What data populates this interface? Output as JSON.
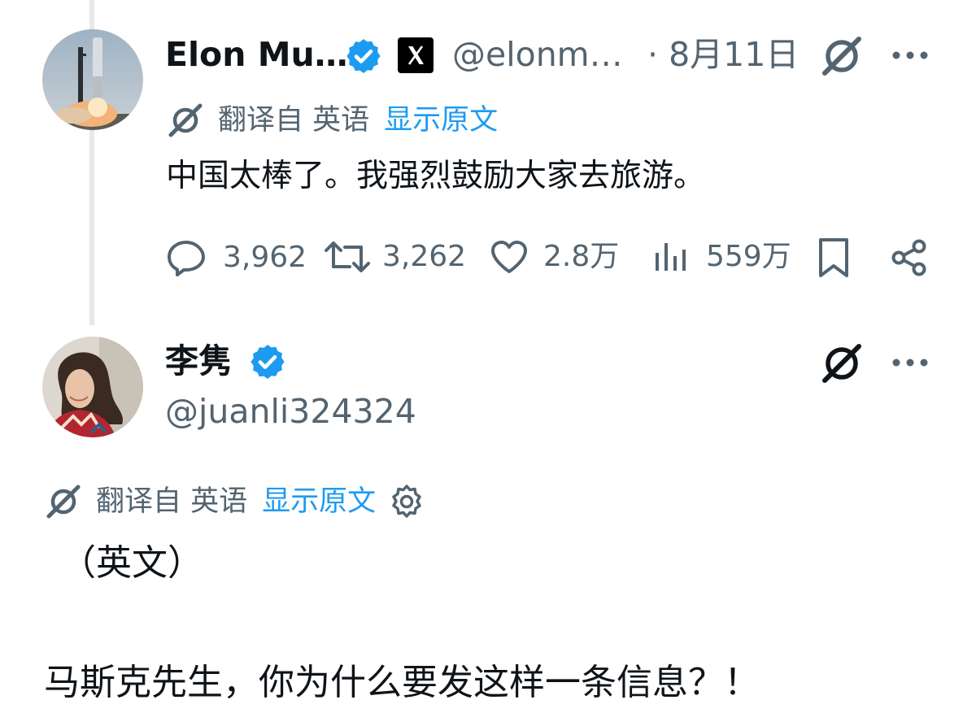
{
  "tweet1": {
    "author_name": "Elon Mu…",
    "handle": "@elonm…",
    "date": "· 8月11日",
    "translation": {
      "label": "翻译自 英语",
      "show_original": "显示原文"
    },
    "text": "中国太棒了。我强烈鼓励大家去旅游。",
    "metrics": {
      "replies": "3,962",
      "retweets": "3,262",
      "likes": "2.8万",
      "views": "559万"
    },
    "icons": [
      "verified-badge-icon",
      "x-logo-icon",
      "grok-icon",
      "more-icon",
      "reply-icon",
      "retweet-icon",
      "like-icon",
      "views-icon",
      "bookmark-icon",
      "share-icon"
    ]
  },
  "tweet2": {
    "author_name": "李隽",
    "handle": "@juanli324324",
    "translation": {
      "label": "翻译自 英语",
      "show_original": "显示原文"
    },
    "line1": "（英文）",
    "line2": "马斯克先生，你为什么要发这样一条信息？！",
    "icons": [
      "verified-badge-icon",
      "grok-icon",
      "more-icon",
      "settings-icon"
    ]
  },
  "colors": {
    "text": "#0f1419",
    "muted": "#536471",
    "link": "#1d9bf0",
    "verified": "#1d9bf0",
    "thread_line": "#e6e9ec"
  }
}
